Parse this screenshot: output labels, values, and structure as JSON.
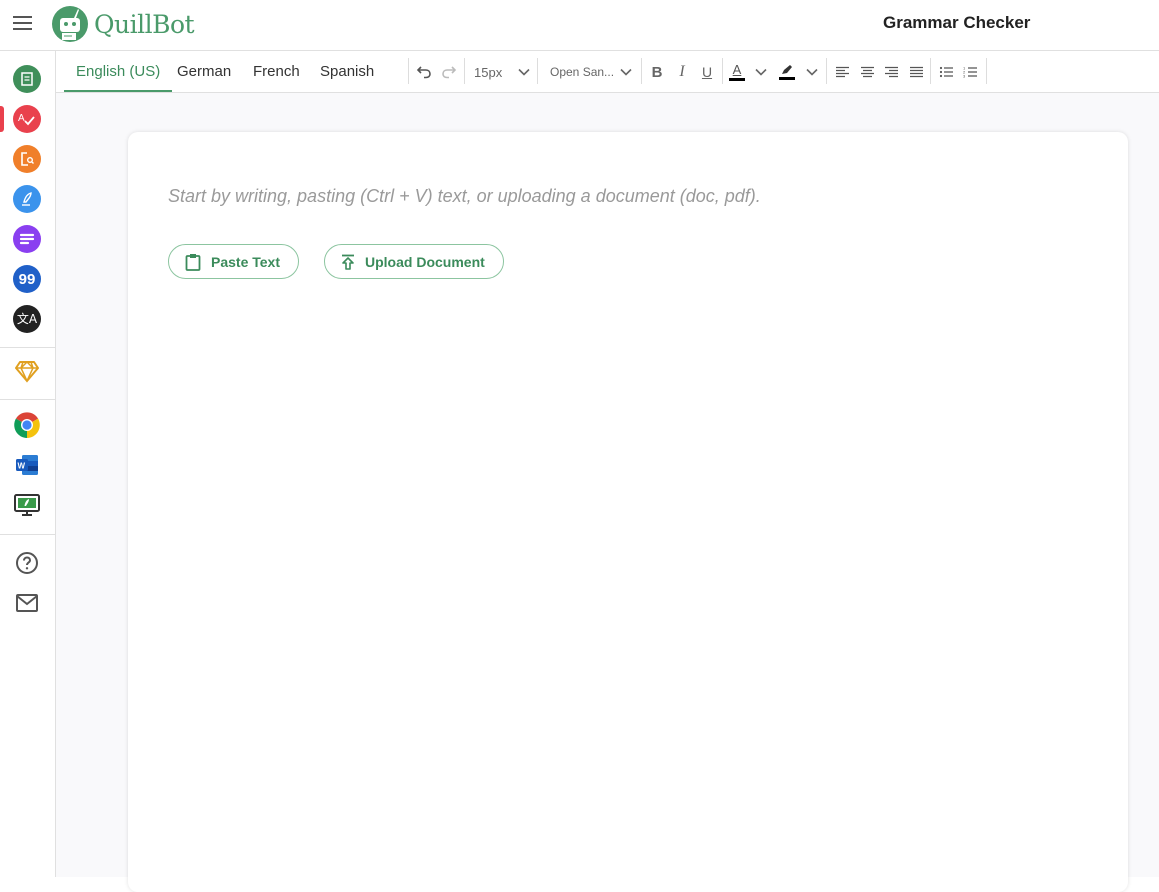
{
  "header": {
    "menu_icon": "hamburger-icon",
    "brand": "QuillBot",
    "page_title": "Grammar Checker"
  },
  "sidebar": {
    "items": [
      {
        "name": "paraphraser",
        "icon": "paraphraser-icon",
        "color": "#3f8f5a"
      },
      {
        "name": "grammar-checker",
        "icon": "grammar-check-icon",
        "color": "#e9414d",
        "active": true
      },
      {
        "name": "plagiarism-checker",
        "icon": "plagiarism-icon",
        "color": "#f07f2a"
      },
      {
        "name": "co-writer",
        "icon": "quill-pen-icon",
        "color": "#3b93ec"
      },
      {
        "name": "summarizer",
        "icon": "summarizer-icon",
        "color": "#8a3ff0"
      },
      {
        "name": "citation-generator",
        "icon": "quote-icon",
        "color": "#2060c8"
      },
      {
        "name": "translator",
        "icon": "translate-icon",
        "color": "#222222"
      },
      {
        "name": "premium",
        "icon": "diamond-icon",
        "color": "#e0a020"
      },
      {
        "name": "chrome-extension",
        "icon": "chrome-icon"
      },
      {
        "name": "word-addin",
        "icon": "word-icon"
      },
      {
        "name": "desktop-app",
        "icon": "desktop-icon"
      },
      {
        "name": "help",
        "icon": "help-icon"
      },
      {
        "name": "contact",
        "icon": "mail-icon"
      }
    ]
  },
  "toolbar": {
    "tabs": [
      {
        "label": "English (US)",
        "active": true
      },
      {
        "label": "German"
      },
      {
        "label": "French"
      },
      {
        "label": "Spanish"
      }
    ],
    "font_size": "15px",
    "font_family": "Open San...",
    "bold": "B",
    "italic": "I",
    "underline": "U",
    "text_color": "A"
  },
  "editor": {
    "placeholder": "Start by writing, pasting (Ctrl + V) text, or uploading a document (doc, pdf).",
    "paste_label": "Paste Text",
    "upload_label": "Upload Document"
  },
  "colors": {
    "brand": "#4a9a6a",
    "accent_text": "#3b8b5b"
  }
}
